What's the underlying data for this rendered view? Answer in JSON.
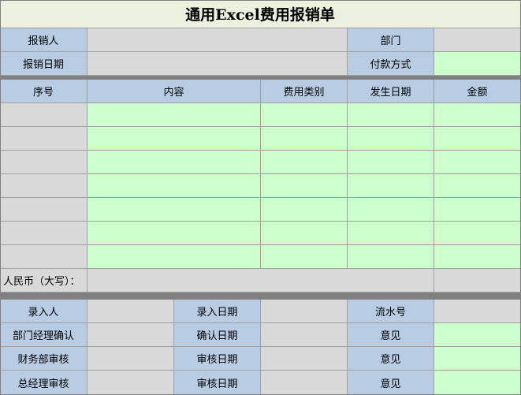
{
  "title": "通用Excel费用报销单",
  "header": {
    "claimant_label": "报销人",
    "department_label": "部门",
    "claim_date_label": "报销日期",
    "payment_method_label": "付款方式"
  },
  "table": {
    "columns": [
      "序号",
      "内容",
      "费用类别",
      "发生日期",
      "金额"
    ],
    "row_count": 7
  },
  "total": {
    "rmb_upper_label": "人民币（大写）："
  },
  "footer": {
    "entered_by_label": "录入人",
    "entry_date_label": "录入日期",
    "serial_no_label": "流水号",
    "dept_manager_confirm_label": "部门经理确认",
    "confirm_date_label": "确认日期",
    "opinion_label_1": "意见",
    "finance_review_label": "财务部审核",
    "review_date_label_1": "审核日期",
    "opinion_label_2": "意见",
    "gm_review_label": "总经理审核",
    "review_date_label_2": "审核日期",
    "opinion_label_3": "意见"
  },
  "colors": {
    "title_bg": "#ebf1de",
    "label_bg": "#b8cce4",
    "input_gray": "#d9d9d9",
    "input_green": "#ccffcc",
    "separator": "#808080"
  }
}
